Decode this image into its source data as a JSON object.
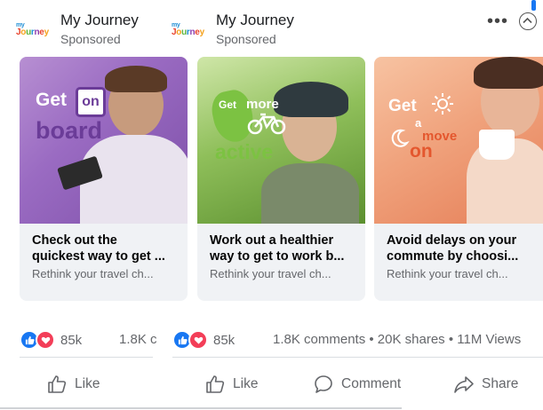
{
  "posts": [
    {
      "brand": {
        "name": "My Journey",
        "sponsored": "Sponsored"
      },
      "reactions": {
        "count": "85k"
      },
      "stats_text": "1.8K c",
      "actions": {
        "like": "Like"
      }
    },
    {
      "brand": {
        "name": "My Journey",
        "sponsored": "Sponsored"
      },
      "reactions": {
        "count": "85k"
      },
      "stats_text": "1.8K comments • 20K shares • 11M Views",
      "actions": {
        "like": "Like",
        "comment": "Comment",
        "share": "Share"
      }
    }
  ],
  "logo": {
    "line1": "my",
    "line2": "Journey"
  },
  "header_controls": {
    "more": "•••"
  },
  "cards": [
    {
      "ad_text": {
        "get": "Get",
        "on": "on",
        "board": "board"
      },
      "title": "Check out the quickest way to get ...",
      "title_line1": "Check out the",
      "title_line2": "quickest way to get ...",
      "subtitle": "Rethink your travel ch..."
    },
    {
      "ad_text": {
        "get": "Get",
        "more": "more",
        "active": "active"
      },
      "title_line1": "Work out a healthier",
      "title_line2": "way to get to work b...",
      "subtitle": "Rethink your travel ch..."
    },
    {
      "ad_text": {
        "get": "Get",
        "a": "a",
        "move": "move",
        "on": "on"
      },
      "title_line1": "Avoid delays on your",
      "title_line2": "commute by choosi...",
      "subtitle": "Rethink your travel ch..."
    }
  ],
  "colors": {
    "facebook_blue": "#1877f2",
    "love_red": "#f33e58",
    "card1_purple": "#8a5cb6",
    "card2_green": "#6fae3a",
    "card3_orange": "#e4572e"
  },
  "icons": {
    "like": "thumbs-up-icon",
    "comment": "comment-bubble-icon",
    "share": "share-arrow-icon",
    "more": "more-dots-icon",
    "collapse": "chevron-up-circle-icon"
  }
}
